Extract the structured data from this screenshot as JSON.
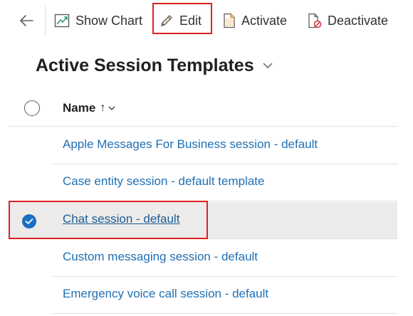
{
  "toolbar": {
    "show_chart_label": "Show Chart",
    "edit_label": "Edit",
    "activate_label": "Activate",
    "deactivate_label": "Deactivate",
    "highlight_color": "#e02020"
  },
  "view": {
    "title": "Active Session Templates"
  },
  "grid": {
    "column_name": "Name",
    "sort_indicator": "↑",
    "rows": [
      {
        "name": "Apple Messages For Business session - default",
        "selected": false
      },
      {
        "name": "Case entity session - default template",
        "selected": false
      },
      {
        "name": "Chat session - default",
        "selected": true
      },
      {
        "name": "Custom messaging session - default",
        "selected": false
      },
      {
        "name": "Emergency voice call session - default",
        "selected": false
      }
    ]
  },
  "colors": {
    "link": "#1f6fb4",
    "selected_row_bg": "#edebe9",
    "check_accent": "#1b6ec2"
  },
  "icons": {
    "back": "arrow-left-icon",
    "show_chart": "chart-icon",
    "edit": "pencil-icon",
    "activate": "document-icon",
    "deactivate": "document-blocked-icon",
    "view_selector": "chevron-down-icon",
    "row_selected": "checkmark-circle-icon"
  }
}
